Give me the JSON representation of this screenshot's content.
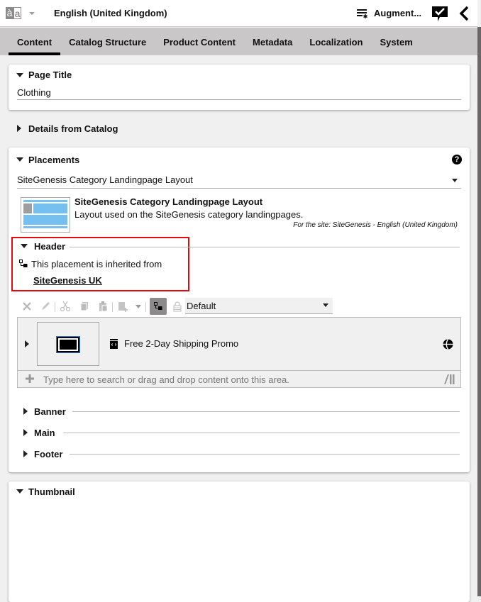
{
  "topbar": {
    "language_icon_left": "à",
    "language_icon_right": "a",
    "language": "English (United Kingdom)",
    "augment_label": "Augment...",
    "icons": [
      "language-icon",
      "chevron-down-icon",
      "augment-icon",
      "checkmark-comment-icon",
      "back-chevron-icon"
    ]
  },
  "tabs": [
    {
      "label": "Content",
      "active": true
    },
    {
      "label": "Catalog Structure",
      "active": false
    },
    {
      "label": "Product Content",
      "active": false
    },
    {
      "label": "Metadata",
      "active": false
    },
    {
      "label": "Localization",
      "active": false
    },
    {
      "label": "System",
      "active": false
    }
  ],
  "page_title_section": {
    "heading": "Page Title",
    "value": "Clothing"
  },
  "details_section": {
    "heading": "Details from Catalog"
  },
  "placements": {
    "heading": "Placements",
    "help_symbol": "?",
    "layout_select_value": "SiteGenesis Category Landingpage Layout",
    "layout_name": "SiteGenesis Category Landingpage Layout",
    "layout_description": "Layout used on the SiteGenesis category landingpages.",
    "site_note": "For the site: SiteGenesis - English (United Kingdom)",
    "header": {
      "heading": "Header",
      "inherited_text": "This placement is inherited from",
      "inherited_link": "SiteGenesis UK",
      "variant_select_value": "Default",
      "toolbar_icons": [
        "delete-icon",
        "edit-icon",
        "cut-icon",
        "copy-icon",
        "paste-icon",
        "add-content-icon",
        "chevron-down-icon",
        "inherit-icon",
        "lock-icon"
      ],
      "items": [
        {
          "title": "Free 2-Day Shipping Promo",
          "type_icon": "teaser-icon",
          "status_icon": "globe-icon"
        }
      ],
      "search_placeholder": "Type here to search or drag and drop content onto this area."
    },
    "subsections": [
      {
        "heading": "Banner"
      },
      {
        "heading": "Main"
      },
      {
        "heading": "Footer"
      }
    ]
  },
  "thumbnail_section": {
    "heading": "Thumbnail"
  },
  "colors": {
    "tab_bar": "#c9c7c8",
    "highlight": "#e4090d",
    "layout_blue": "#74c0f0",
    "inherit_button": "#8d8a8b"
  }
}
